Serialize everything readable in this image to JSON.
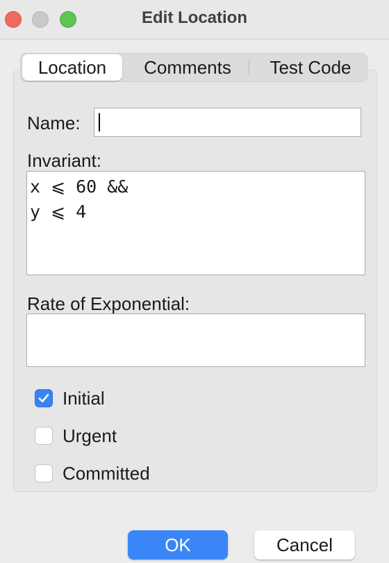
{
  "window": {
    "title": "Edit Location"
  },
  "tabs": [
    {
      "label": "Location",
      "active": true
    },
    {
      "label": "Comments",
      "active": false
    },
    {
      "label": "Test Code",
      "active": false
    }
  ],
  "form": {
    "name_label": "Name:",
    "name_value": "",
    "invariant_label": "Invariant:",
    "invariant_value": "x ⩽ 60 &&\ny ⩽ 4",
    "rate_label": "Rate of Exponential:",
    "rate_value": ""
  },
  "checkboxes": [
    {
      "label": "Initial",
      "checked": true
    },
    {
      "label": "Urgent",
      "checked": false
    },
    {
      "label": "Committed",
      "checked": false
    }
  ],
  "buttons": {
    "ok_label": "OK",
    "cancel_label": "Cancel"
  },
  "colors": {
    "accent": "#3a86f7",
    "close": "#ee6a5f",
    "maximize": "#5fc454"
  },
  "icons": {
    "close": "close-icon",
    "minimize": "minimize-icon",
    "maximize": "maximize-icon",
    "check": "checkmark-icon"
  }
}
